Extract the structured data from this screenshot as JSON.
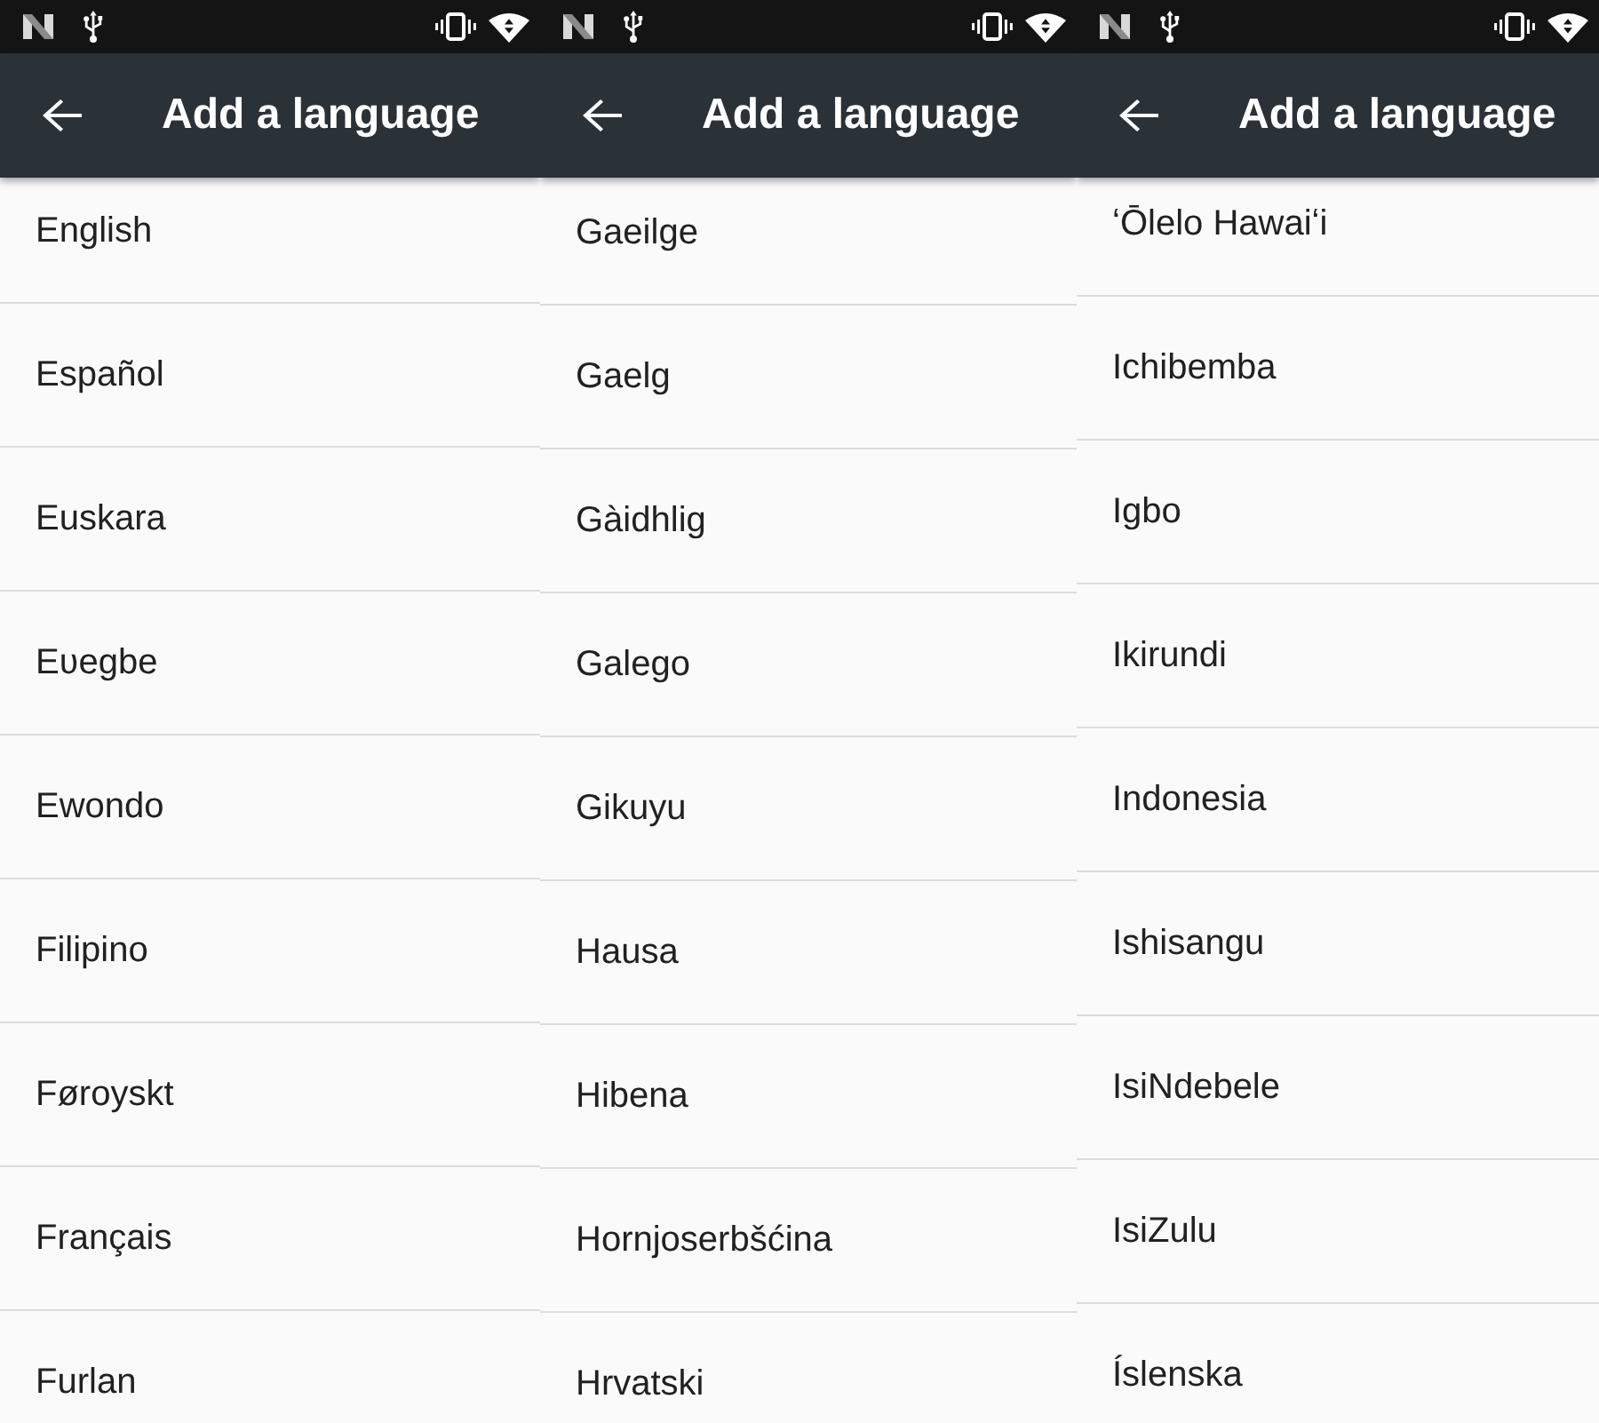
{
  "screens": [
    {
      "app_bar": {
        "title": "Add a language"
      },
      "languages": [
        "English",
        "Español",
        "Euskara",
        "Eʋegbe",
        "Ewondo",
        "Filipino",
        "Føroyskt",
        "Français",
        "Furlan"
      ]
    },
    {
      "app_bar": {
        "title": "Add a language"
      },
      "languages": [
        "Gaeilge",
        "Gaelg",
        "Gàidhlig",
        "Galego",
        "Gikuyu",
        "Hausa",
        "Hibena",
        "Hornjoserbšćina",
        "Hrvatski"
      ]
    },
    {
      "app_bar": {
        "title": "Add a language"
      },
      "languages": [
        "ʻŌlelo Hawaiʻi",
        "Ichibemba",
        "Igbo",
        "Ikirundi",
        "Indonesia",
        "Ishisangu",
        "IsiNdebele",
        "IsiZulu",
        "Íslenska"
      ]
    }
  ]
}
